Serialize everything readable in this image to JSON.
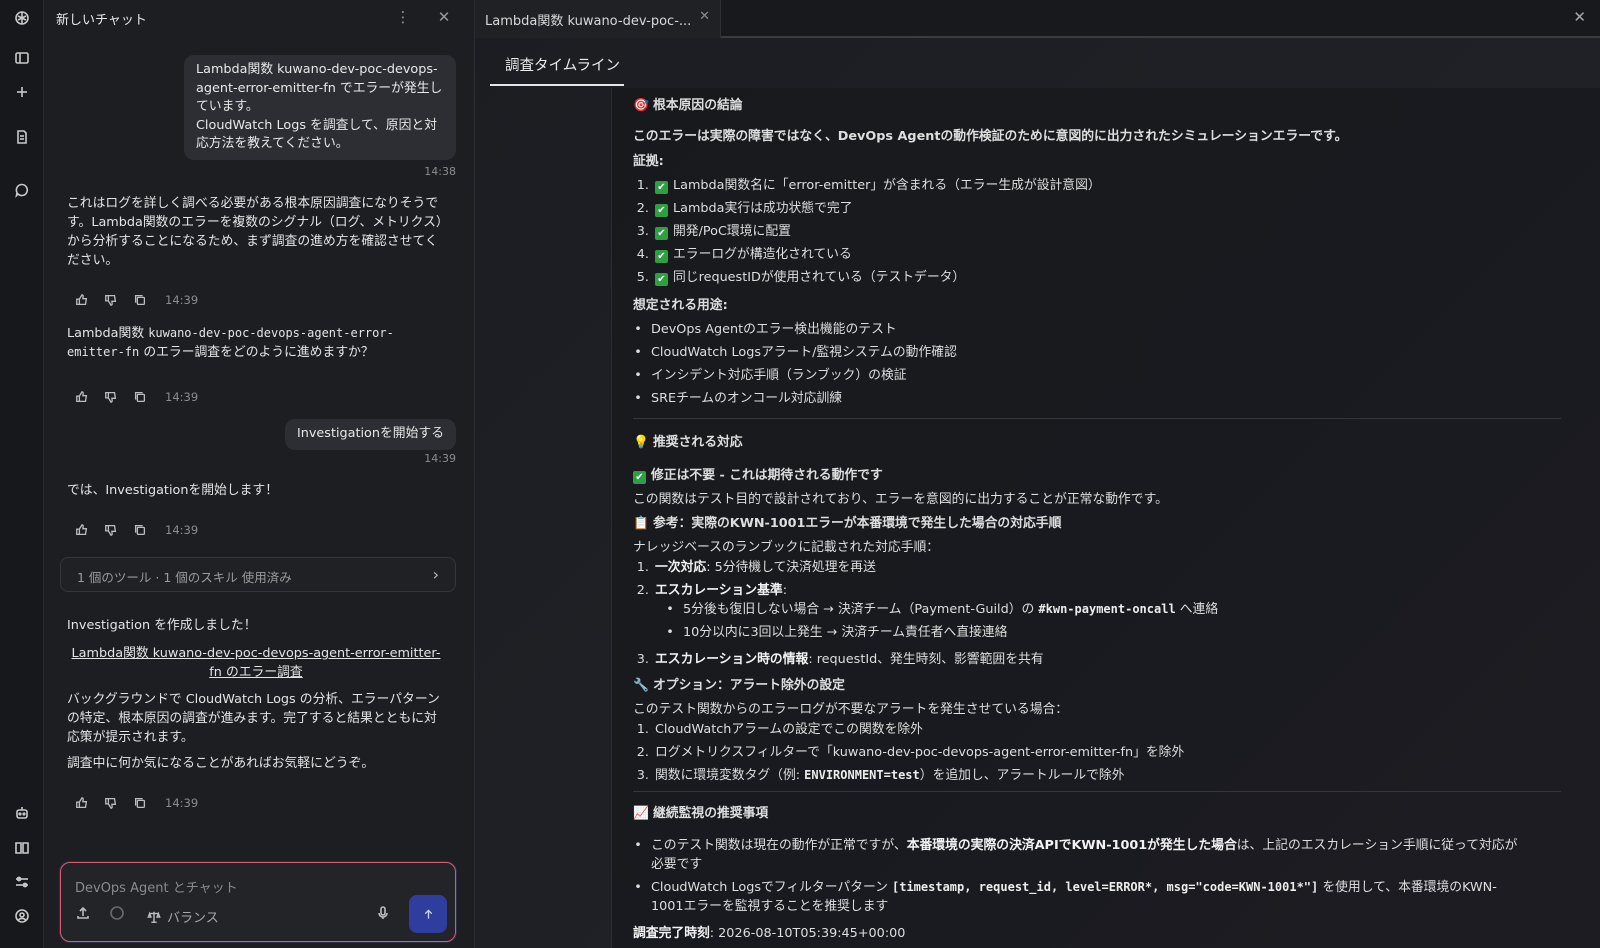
{
  "sidebar_rail": {
    "icons": [
      "logo-icon",
      "panel-icon",
      "plus-icon",
      "document-icon",
      "chat-bubble-icon",
      "robot-icon",
      "book-icon",
      "settings-sliders-icon",
      "user-circle-icon"
    ]
  },
  "chat": {
    "title": "新しいチャット",
    "user_msg1_lines": [
      "Lambda関数 kuwano-dev-poc-devops-",
      "agent-error-emitter-fn でエラーが発生し",
      "ています。",
      "CloudWatch Logs を調査して、原因と対",
      "応方法を教えてください。"
    ],
    "ts1": "14:38",
    "agent_msg1": "これはログを詳しく調べる必要がある根本原因調査になりそうです。Lambda関数のエラーを複数のシグナル（ログ、メトリクス）から分析することになるため、まず調査の進め方を確認させてください。",
    "ts2": "14:39",
    "agent_msg2_prefix": "Lambda関数 ",
    "agent_msg2_code": "kuwano-dev-poc-devops-agent-error-emitter-fn",
    "agent_msg2_suffix": " のエラー調査をどのように進めますか？",
    "ts3": "14:39",
    "user_msg2": "Investigationを開始する",
    "ts4": "14:39",
    "agent_msg3": "では、Investigationを開始します！",
    "ts5": "14:39",
    "tools_label": "1 個のツール · 1 個のスキル 使用済み",
    "agent_msg4_p1": "Investigation を作成しました！",
    "agent_msg4_link": "Lambda関数 kuwano-dev-poc-devops-agent-error-emitter-fn のエラー調査",
    "agent_msg4_p2": "バックグラウンドで CloudWatch Logs の分析、エラーパターンの特定、根本原因の調査が進みます。完了すると結果とともに対応策が提示されます。",
    "agent_msg4_p3": "調査中に何か気になることがあればお気軽にどうぞ。",
    "ts6": "14:39",
    "composer_placeholder": "DevOps Agent とチャット",
    "balance_label": "バランス"
  },
  "right": {
    "tab_title": "Lambda関数 kuwano-dev-poc-...",
    "subtab": "調査タイムライン",
    "root_cause_heading": "根本原因の結論",
    "conclusion": "このエラーは実際の障害ではなく、DevOps Agentの動作検証のために意図的に出力されたシミュレーションエラーです。",
    "evidence_label": "証拠:",
    "evidence": [
      "Lambda関数名に「error-emitter」が含まれる（エラー生成が設計意図）",
      "Lambda実行は成功状態で完了",
      "開発/PoC環境に配置",
      "エラーログが構造化されている",
      "同じrequestIDが使用されている（テストデータ）"
    ],
    "usage_label": "想定される用途:",
    "usages": [
      "DevOps Agentのエラー検出機能のテスト",
      "CloudWatch Logsアラート/監視システムの動作確認",
      "インシデント対応手順（ランブック）の検証",
      "SREチームのオンコール対応訓練"
    ],
    "recommend_heading": "推奨される対応",
    "no_fix_heading": "修正は不要 - これは期待される動作です",
    "no_fix_text": "この関数はテスト目的で設計されており、エラーを意図的に出力することが正常な動作です。",
    "ref_heading": "参考：実際のKWN-1001エラーが本番環境で発生した場合の対応手順",
    "ref_intro": "ナレッジベースのランブックに記載された対応手順：",
    "ref1_bold": "一次対応",
    "ref1_text": ": 5分待機して決済処理を再送",
    "ref2_bold": "エスカレーション基準",
    "ref2_colon": ":",
    "ref2_sub1_prefix": "5分後も復旧しない場合 → 決済チーム（Payment-Guild）の ",
    "ref2_sub1_code": "#kwn-payment-oncall",
    "ref2_sub1_suffix": " へ連絡",
    "ref2_sub2": "10分以内に3回以上発生 → 決済チーム責任者へ直接連絡",
    "ref3_bold": "エスカレーション時の情報",
    "ref3_text": ": requestId、発生時刻、影響範囲を共有",
    "option_heading": "オプション：アラート除外の設定",
    "option_intro": "このテスト関数からのエラーログが不要なアラートを発生させている場合：",
    "option1": "CloudWatchアラームの設定でこの関数を除外",
    "option2": "ログメトリクスフィルターで「kuwano-dev-poc-devops-agent-error-emitter-fn」を除外",
    "option3_prefix": "関数に環境変数タグ（例: ",
    "option3_code": "ENVIRONMENT=test",
    "option3_suffix": "）を追加し、アラートルールで除外",
    "monitor_heading": "継続監視の推奨事項",
    "monitor1_prefix": "このテスト関数は現在の動作が正常ですが、",
    "monitor1_bold": "本番環境の実際の決済APIでKWN-1001が発生した場合",
    "monitor1_suffix": "は、上記のエスカレーション手順に従って対応が",
    "monitor1_line2": "必要です",
    "monitor2_prefix": "CloudWatch Logsでフィルターパターン ",
    "monitor2_code": "[timestamp, request_id, level=ERROR*, msg=\"code=KWN-1001*\"]",
    "monitor2_suffix": " を使用して、本番環境のKWN-",
    "monitor2_line2": "1001エラーを監視することを推奨します",
    "complete_label": "調査完了時刻",
    "complete_value": ": 2026-08-10T05:39:45+00:00"
  }
}
